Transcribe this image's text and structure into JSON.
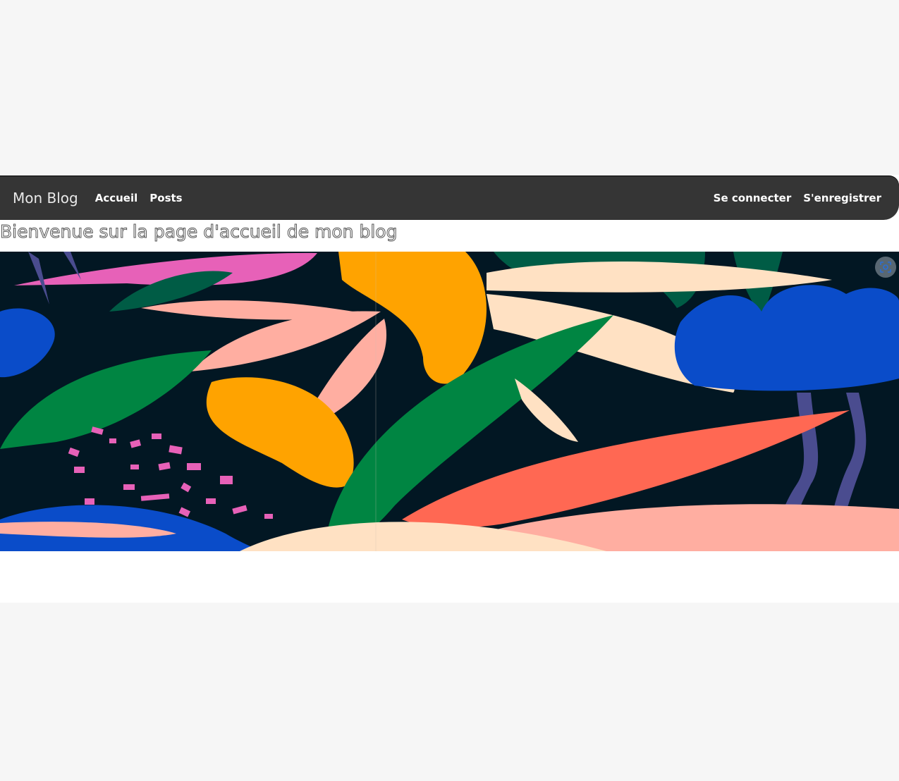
{
  "navbar": {
    "brand": "Mon Blog",
    "links": [
      {
        "label": "Accueil"
      },
      {
        "label": "Posts"
      }
    ],
    "auth": {
      "login": "Se connecter",
      "register": "S'enregistrer"
    },
    "bg_color": "#353535"
  },
  "main": {
    "welcome_text": "Bienvenue sur la page d'accueil de mon blog",
    "banner": {
      "palette": [
        "#021723",
        "#0a4cc9",
        "#008542",
        "#ffa300",
        "#ffaea1",
        "#ff6853",
        "#ffe1c3",
        "#e761b8",
        "#005c45"
      ],
      "visual_search_icon": "lens-scan-icon"
    }
  }
}
